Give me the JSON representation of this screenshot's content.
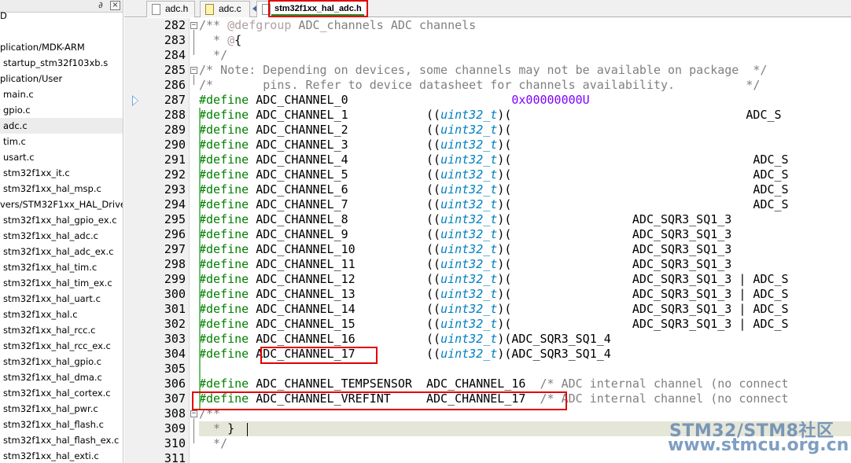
{
  "panel": {
    "pin_glyph": "∂",
    "close_glyph": "×",
    "items": [
      {
        "label": "D",
        "kind": "group"
      },
      {
        "label": "",
        "kind": "group"
      },
      {
        "label": "plication/MDK-ARM",
        "kind": "group"
      },
      {
        "label": "startup_stm32f103xb.s",
        "kind": "file"
      },
      {
        "label": "plication/User",
        "kind": "group"
      },
      {
        "label": "main.c",
        "kind": "file"
      },
      {
        "label": "gpio.c",
        "kind": "file"
      },
      {
        "label": "adc.c",
        "kind": "file",
        "selected": true
      },
      {
        "label": "tim.c",
        "kind": "file"
      },
      {
        "label": "usart.c",
        "kind": "file"
      },
      {
        "label": "stm32f1xx_it.c",
        "kind": "file"
      },
      {
        "label": "stm32f1xx_hal_msp.c",
        "kind": "file"
      },
      {
        "label": "vers/STM32F1xx_HAL_Driver",
        "kind": "group"
      },
      {
        "label": "stm32f1xx_hal_gpio_ex.c",
        "kind": "file"
      },
      {
        "label": "stm32f1xx_hal_adc.c",
        "kind": "file"
      },
      {
        "label": "stm32f1xx_hal_adc_ex.c",
        "kind": "file"
      },
      {
        "label": "stm32f1xx_hal_tim.c",
        "kind": "file"
      },
      {
        "label": "stm32f1xx_hal_tim_ex.c",
        "kind": "file"
      },
      {
        "label": "stm32f1xx_hal_uart.c",
        "kind": "file"
      },
      {
        "label": "stm32f1xx_hal.c",
        "kind": "file"
      },
      {
        "label": "stm32f1xx_hal_rcc.c",
        "kind": "file"
      },
      {
        "label": "stm32f1xx_hal_rcc_ex.c",
        "kind": "file"
      },
      {
        "label": "stm32f1xx_hal_gpio.c",
        "kind": "file"
      },
      {
        "label": "stm32f1xx_hal_dma.c",
        "kind": "file"
      },
      {
        "label": "stm32f1xx_hal_cortex.c",
        "kind": "file"
      },
      {
        "label": "stm32f1xx_hal_pwr.c",
        "kind": "file"
      },
      {
        "label": "stm32f1xx_hal_flash.c",
        "kind": "file"
      },
      {
        "label": "stm32f1xx_hal_flash_ex.c",
        "kind": "file"
      },
      {
        "label": "stm32f1xx_hal_exti.c",
        "kind": "file"
      }
    ]
  },
  "tabs": [
    {
      "label": "adc.h",
      "icon": "file-icon",
      "active": false
    },
    {
      "label": "adc.c",
      "icon": "c-file-icon",
      "active": false
    },
    {
      "label": "stm32f1xx_hal_adc.h",
      "icon": "file-icon",
      "active": true
    }
  ],
  "editor": {
    "current_line": 309,
    "exec_marker_line": 287,
    "lines": [
      {
        "n": "282",
        "fold": "minus",
        "t": [
          [
            "cm",
            "/** "
          ],
          [
            "dox",
            "@defgroup"
          ],
          [
            "cm",
            " ADC_channels ADC channels"
          ]
        ]
      },
      {
        "n": "283",
        "t": [
          [
            "cm",
            "  * "
          ],
          [
            "dox",
            "@"
          ],
          [
            "punct",
            "{"
          ]
        ]
      },
      {
        "n": "284",
        "t": [
          [
            "cm",
            "  */"
          ]
        ]
      },
      {
        "n": "285",
        "fold": "minus",
        "t": [
          [
            "cm",
            "/* Note: Depending on devices, some channels may not be available on package  */"
          ]
        ]
      },
      {
        "n": "286",
        "t": [
          [
            "cm",
            "/*       pins. Refer to device datasheet for channels availability.          */"
          ]
        ]
      },
      {
        "n": "287",
        "t": [
          [
            "dir",
            "#define"
          ],
          [
            "id",
            " ADC_CHANNEL_0                       "
          ],
          [
            "num",
            "0x00000000U"
          ]
        ]
      },
      {
        "n": "288",
        "t": [
          [
            "dir",
            "#define"
          ],
          [
            "id",
            " ADC_CHANNEL_1           (("
          ],
          [
            "type",
            "uint32_t"
          ],
          [
            "id",
            ")(                                 ADC_S"
          ]
        ]
      },
      {
        "n": "289",
        "t": [
          [
            "dir",
            "#define"
          ],
          [
            "id",
            " ADC_CHANNEL_2           (("
          ],
          [
            "type",
            "uint32_t"
          ],
          [
            "id",
            ")("
          ]
        ]
      },
      {
        "n": "290",
        "t": [
          [
            "dir",
            "#define"
          ],
          [
            "id",
            " ADC_CHANNEL_3           (("
          ],
          [
            "type",
            "uint32_t"
          ],
          [
            "id",
            ")("
          ]
        ]
      },
      {
        "n": "291",
        "t": [
          [
            "dir",
            "#define"
          ],
          [
            "id",
            " ADC_CHANNEL_4           (("
          ],
          [
            "type",
            "uint32_t"
          ],
          [
            "id",
            ")(                                  ADC_S"
          ]
        ]
      },
      {
        "n": "292",
        "t": [
          [
            "dir",
            "#define"
          ],
          [
            "id",
            " ADC_CHANNEL_5           (("
          ],
          [
            "type",
            "uint32_t"
          ],
          [
            "id",
            ")(                                  ADC_S"
          ]
        ]
      },
      {
        "n": "293",
        "t": [
          [
            "dir",
            "#define"
          ],
          [
            "id",
            " ADC_CHANNEL_6           (("
          ],
          [
            "type",
            "uint32_t"
          ],
          [
            "id",
            ")(                                  ADC_S"
          ]
        ]
      },
      {
        "n": "294",
        "t": [
          [
            "dir",
            "#define"
          ],
          [
            "id",
            " ADC_CHANNEL_7           (("
          ],
          [
            "type",
            "uint32_t"
          ],
          [
            "id",
            ")(                                  ADC_S"
          ]
        ]
      },
      {
        "n": "295",
        "t": [
          [
            "dir",
            "#define"
          ],
          [
            "id",
            " ADC_CHANNEL_8           (("
          ],
          [
            "type",
            "uint32_t"
          ],
          [
            "id",
            ")(                 ADC_SQR3_SQ1_3"
          ]
        ]
      },
      {
        "n": "296",
        "t": [
          [
            "dir",
            "#define"
          ],
          [
            "id",
            " ADC_CHANNEL_9           (("
          ],
          [
            "type",
            "uint32_t"
          ],
          [
            "id",
            ")(                 ADC_SQR3_SQ1_3"
          ]
        ]
      },
      {
        "n": "297",
        "t": [
          [
            "dir",
            "#define"
          ],
          [
            "id",
            " ADC_CHANNEL_10          (("
          ],
          [
            "type",
            "uint32_t"
          ],
          [
            "id",
            ")(                 ADC_SQR3_SQ1_3"
          ]
        ]
      },
      {
        "n": "298",
        "t": [
          [
            "dir",
            "#define"
          ],
          [
            "id",
            " ADC_CHANNEL_11          (("
          ],
          [
            "type",
            "uint32_t"
          ],
          [
            "id",
            ")(                 ADC_SQR3_SQ1_3"
          ]
        ]
      },
      {
        "n": "299",
        "t": [
          [
            "dir",
            "#define"
          ],
          [
            "id",
            " ADC_CHANNEL_12          (("
          ],
          [
            "type",
            "uint32_t"
          ],
          [
            "id",
            ")(                 ADC_SQR3_SQ1_3 | ADC_S"
          ]
        ]
      },
      {
        "n": "300",
        "t": [
          [
            "dir",
            "#define"
          ],
          [
            "id",
            " ADC_CHANNEL_13          (("
          ],
          [
            "type",
            "uint32_t"
          ],
          [
            "id",
            ")(                 ADC_SQR3_SQ1_3 | ADC_S"
          ]
        ]
      },
      {
        "n": "301",
        "t": [
          [
            "dir",
            "#define"
          ],
          [
            "id",
            " ADC_CHANNEL_14          (("
          ],
          [
            "type",
            "uint32_t"
          ],
          [
            "id",
            ")(                 ADC_SQR3_SQ1_3 | ADC_S"
          ]
        ]
      },
      {
        "n": "302",
        "t": [
          [
            "dir",
            "#define"
          ],
          [
            "id",
            " ADC_CHANNEL_15          (("
          ],
          [
            "type",
            "uint32_t"
          ],
          [
            "id",
            ")(                 ADC_SQR3_SQ1_3 | ADC_S"
          ]
        ]
      },
      {
        "n": "303",
        "t": [
          [
            "dir",
            "#define"
          ],
          [
            "id",
            " ADC_CHANNEL_16          (("
          ],
          [
            "type",
            "uint32_t"
          ],
          [
            "id",
            ")(ADC_SQR3_SQ1_4"
          ]
        ]
      },
      {
        "n": "304",
        "t": [
          [
            "dir",
            "#define"
          ],
          [
            "id",
            " ADC_CHANNEL_17          (("
          ],
          [
            "type",
            "uint32_t"
          ],
          [
            "id",
            ")(ADC_SQR3_SQ1_4"
          ]
        ]
      },
      {
        "n": "305",
        "t": []
      },
      {
        "n": "306",
        "t": [
          [
            "dir",
            "#define"
          ],
          [
            "id",
            " ADC_CHANNEL_TEMPSENSOR  ADC_CHANNEL_16  "
          ],
          [
            "cmi",
            "/* ADC internal channel (no connect"
          ]
        ]
      },
      {
        "n": "307",
        "t": [
          [
            "dir",
            "#define"
          ],
          [
            "id",
            " ADC_CHANNEL_VREFINT     ADC_CHANNEL_17  "
          ],
          [
            "cmi",
            "/* ADC internal channel (no connect"
          ]
        ]
      },
      {
        "n": "308",
        "fold": "minus",
        "t": [
          [
            "cm",
            "/**"
          ]
        ]
      },
      {
        "n": "309",
        "t": [
          [
            "cm",
            "  * "
          ],
          [
            "punct",
            "}"
          ]
        ]
      },
      {
        "n": "310",
        "t": [
          [
            "cm",
            "  */"
          ]
        ]
      },
      {
        "n": "311",
        "t": []
      }
    ]
  },
  "watermark": {
    "title": "STM32/STM8社区",
    "url": "www.stmcu.org.cn"
  }
}
